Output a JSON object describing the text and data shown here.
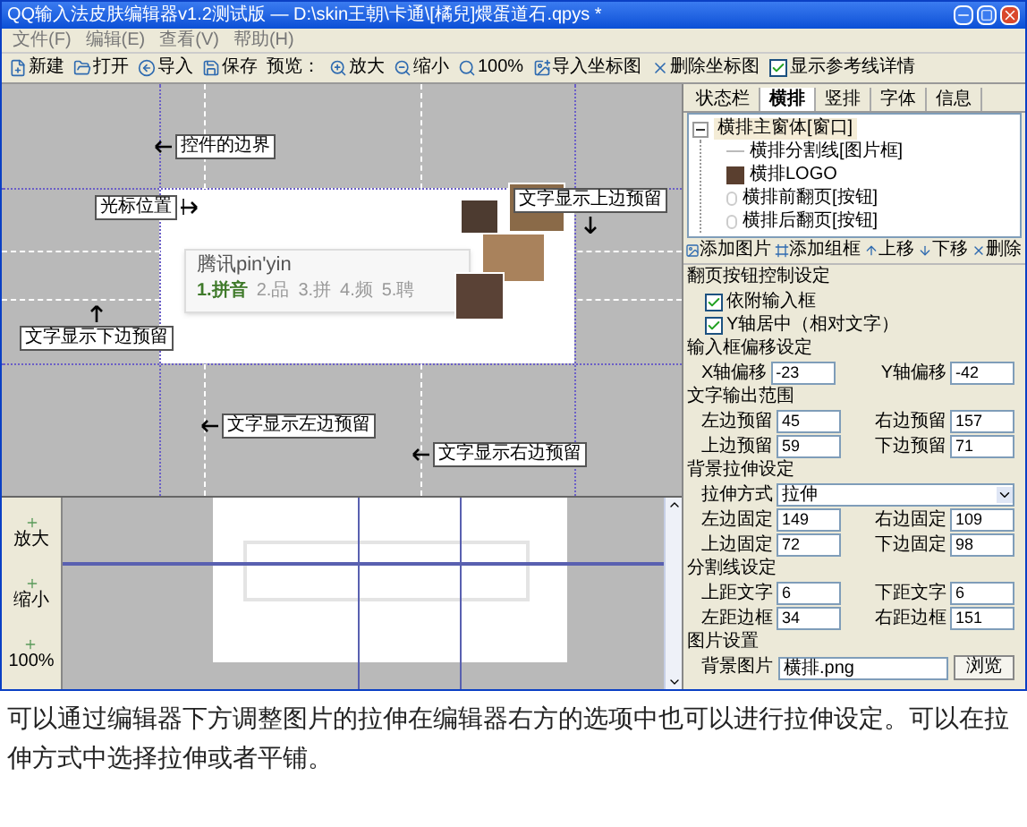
{
  "window": {
    "title": "QQ输入法皮肤编辑器v1.2测试版 — D:\\skin王朝\\卡通\\[橘兒]煨蛋道石.qpys *"
  },
  "menu": [
    "文件(F)",
    "编辑(E)",
    "查看(V)",
    "帮助(H)"
  ],
  "toolbar": [
    {
      "kind": "button",
      "label": "新建"
    },
    {
      "kind": "button",
      "label": "打开"
    },
    {
      "kind": "button",
      "label": "导入"
    },
    {
      "kind": "button",
      "label": "保存"
    },
    {
      "kind": "label",
      "label": "预览："
    },
    {
      "kind": "button",
      "label": "放大"
    },
    {
      "kind": "button",
      "label": "缩小"
    },
    {
      "kind": "button",
      "label": "100%"
    },
    {
      "kind": "button",
      "label": "导入坐标图"
    },
    {
      "kind": "button",
      "label": "删除坐标图"
    },
    {
      "kind": "check",
      "label": "显示参考线详情",
      "checked": true
    }
  ],
  "canvas": {
    "callouts": [
      {
        "text": "控件的边界",
        "kind": "left"
      },
      {
        "text": "光标位置",
        "kind": "right"
      },
      {
        "text": "文字显示上边预留",
        "kind": "down"
      },
      {
        "text": "文字显示下边预留",
        "kind": "up"
      },
      {
        "text": "文字显示左边预留",
        "kind": "left"
      },
      {
        "text": "文字显示右边预留",
        "kind": "left"
      }
    ],
    "composition": "腾讯pin'yin",
    "candidates": [
      {
        "text": "1.拼音",
        "selected": true
      },
      {
        "text": "2.品",
        "selected": false
      },
      {
        "text": "3.拼",
        "selected": false
      },
      {
        "text": "4.频",
        "selected": false
      },
      {
        "text": "5.聘",
        "selected": false
      }
    ]
  },
  "zoom_buttons": [
    "放大",
    "缩小",
    "100%"
  ],
  "tabs": [
    {
      "label": "状态栏",
      "selected": false
    },
    {
      "label": "横排",
      "selected": true
    },
    {
      "label": "竖排",
      "selected": false
    },
    {
      "label": "字体",
      "selected": false
    },
    {
      "label": "信息",
      "selected": false
    }
  ],
  "tree": [
    {
      "label": "横排主窗体[窗口]",
      "selected": true,
      "expanded": true,
      "children": [
        {
          "label": "横排分割线[图片框]",
          "kind": "line"
        },
        {
          "label": "横排LOGO",
          "kind": "image"
        },
        {
          "label": "横排前翻页[按钮]",
          "kind": "button"
        },
        {
          "label": "横排后翻页[按钮]",
          "kind": "button"
        }
      ]
    }
  ],
  "tree_toolbar": [
    "添加图片",
    "添加组框",
    "上移",
    "下移",
    "删除"
  ],
  "form": [
    {
      "title": "翻页按钮控制设定",
      "rows": [
        {
          "kind": "checks",
          "items": [
            {
              "label": "依附输入框",
              "checked": true
            },
            {
              "label": "Y轴居中（相对文字）",
              "checked": true
            }
          ]
        }
      ]
    },
    {
      "title": "输入框偏移设定",
      "rows": [
        {
          "kind": "fields",
          "fields": [
            {
              "label": "X轴偏移",
              "value": "-23"
            },
            {
              "label": "Y轴偏移",
              "value": "-42"
            }
          ]
        }
      ]
    },
    {
      "title": "文字输出范围",
      "rows": [
        {
          "kind": "fields",
          "fields": [
            {
              "label": "左边预留",
              "value": "45"
            },
            {
              "label": "右边预留",
              "value": "157"
            }
          ]
        },
        {
          "kind": "fields",
          "fields": [
            {
              "label": "上边预留",
              "value": "59"
            },
            {
              "label": "下边预留",
              "value": "71"
            }
          ]
        }
      ]
    },
    {
      "title": "背景拉伸设定",
      "rows": [
        {
          "kind": "select",
          "label": "拉伸方式",
          "value": "拉伸"
        },
        {
          "kind": "fields",
          "fields": [
            {
              "label": "左边固定",
              "value": "149"
            },
            {
              "label": "右边固定",
              "value": "109"
            }
          ]
        },
        {
          "kind": "fields",
          "fields": [
            {
              "label": "上边固定",
              "value": "72"
            },
            {
              "label": "下边固定",
              "value": "98"
            }
          ]
        }
      ]
    },
    {
      "title": "分割线设定",
      "rows": [
        {
          "kind": "fields",
          "fields": [
            {
              "label": "上距文字",
              "value": "6"
            },
            {
              "label": "下距文字",
              "value": "6"
            }
          ]
        },
        {
          "kind": "fields",
          "fields": [
            {
              "label": "左距边框",
              "value": "34"
            },
            {
              "label": "右距边框",
              "value": "151"
            }
          ]
        }
      ]
    },
    {
      "title": "图片设置",
      "rows": [
        {
          "kind": "file",
          "label": "背景图片",
          "value": "横排.png",
          "button": "浏览"
        }
      ]
    }
  ],
  "caption": "可以通过编辑器下方调整图片的拉伸在编辑器右方的选项中也可以进行拉伸设定。可以在拉伸方式中选择拉伸或者平铺。"
}
